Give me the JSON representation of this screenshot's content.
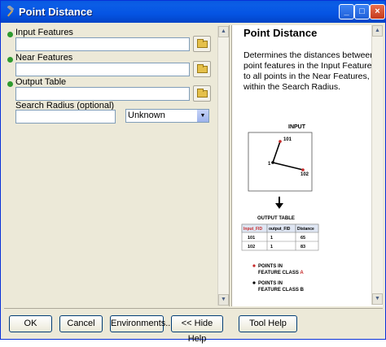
{
  "window": {
    "title": "Point Distance"
  },
  "form": {
    "input_features": {
      "label": "Input Features",
      "value": ""
    },
    "near_features": {
      "label": "Near Features",
      "value": ""
    },
    "output_table": {
      "label": "Output Table",
      "value": ""
    },
    "search_radius": {
      "label": "Search Radius (optional)",
      "value": "",
      "unit": "Unknown"
    }
  },
  "help": {
    "title": "Point Distance",
    "description": "Determines the distances between point features in the Input Features to all points in the Near Features, within the Search Radius.",
    "diagram": {
      "input_label": "INPUT",
      "point_101": "101",
      "point_1": "1",
      "point_102": "102",
      "output_label": "OUTPUT TABLE",
      "columns": [
        "Input_FID",
        "output_FID",
        "Distance"
      ],
      "rows": [
        [
          "101",
          "1",
          "65"
        ],
        [
          "102",
          "1",
          "83"
        ]
      ],
      "legend_a": "POINTS IN FEATURE CLASS A",
      "legend_a_line1": "POINTS IN",
      "legend_a_line2_prefix": "FEATURE CLASS",
      "legend_a_letter": "A",
      "legend_b_line1": "POINTS IN",
      "legend_b_line2_prefix": "FEATURE CLASS",
      "legend_b_letter": "B",
      "color_a": "#c62828",
      "color_b": "#000000"
    }
  },
  "buttons": {
    "ok": "OK",
    "cancel": "Cancel",
    "environments": "Environments...",
    "hide_help": "<< Hide Help",
    "tool_help": "Tool Help"
  }
}
